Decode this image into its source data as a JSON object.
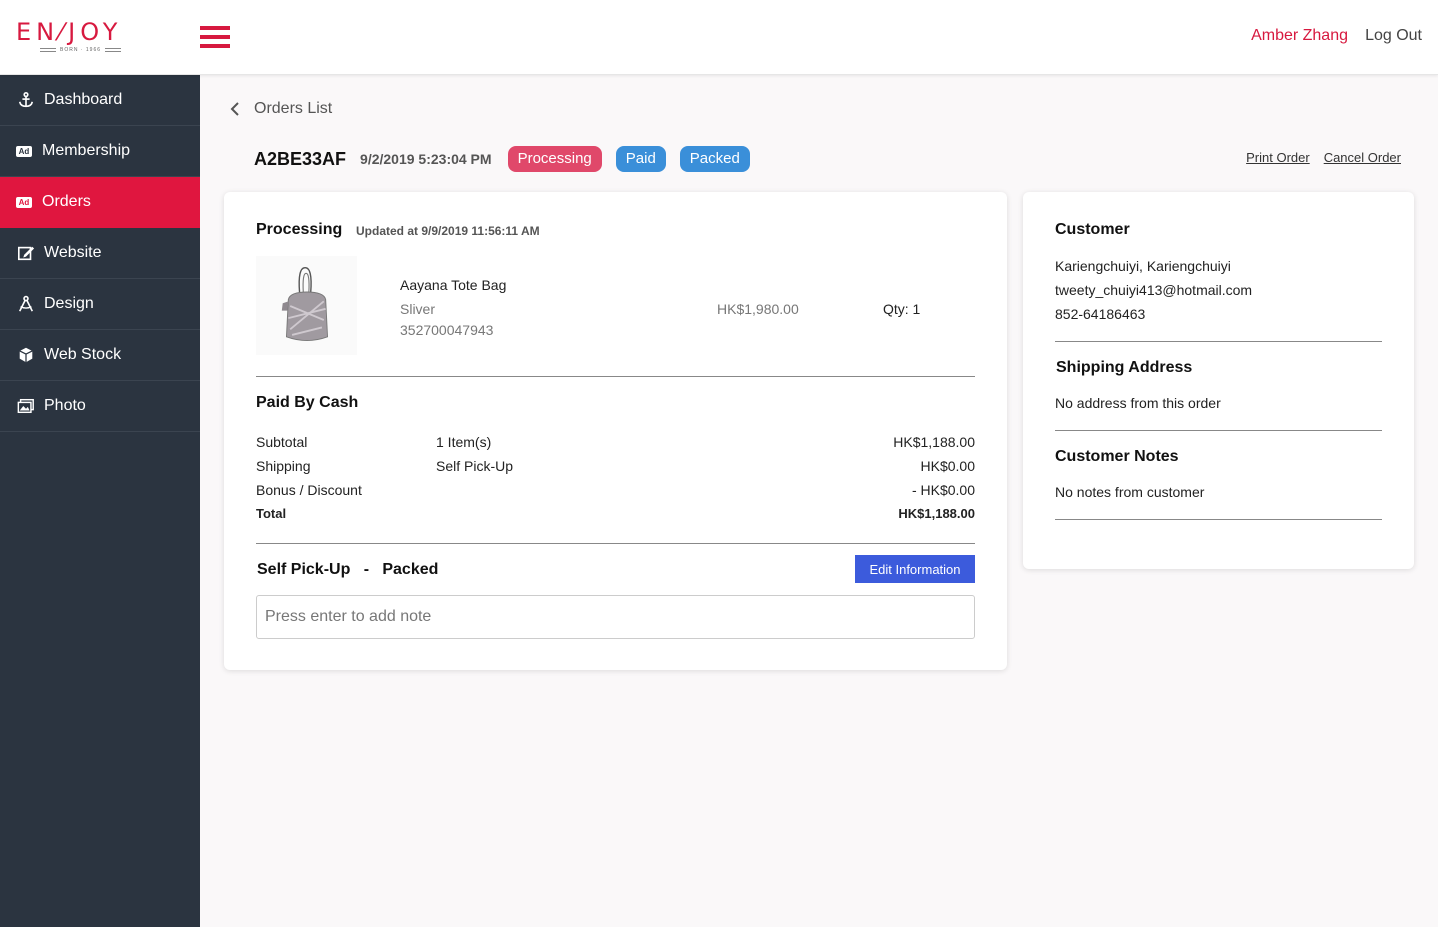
{
  "header": {
    "logo_text": "EN⁄JOY",
    "logo_sub": "BORN · 1966",
    "user_name": "Amber Zhang",
    "logout_label": "Log Out"
  },
  "sidebar": {
    "items": [
      {
        "label": "Dashboard",
        "icon": "anchor-icon"
      },
      {
        "label": "Membership",
        "icon": "ad-icon"
      },
      {
        "label": "Orders",
        "icon": "ad-icon",
        "active": true
      },
      {
        "label": "Website",
        "icon": "edit-icon"
      },
      {
        "label": "Design",
        "icon": "design-icon"
      },
      {
        "label": "Web Stock",
        "icon": "cube-icon"
      },
      {
        "label": "Photo",
        "icon": "images-icon"
      }
    ]
  },
  "breadcrumb": {
    "back_label": "Orders List"
  },
  "order": {
    "id": "A2BE33AF",
    "date": "9/2/2019 5:23:04 PM",
    "badges": [
      "Processing",
      "Paid",
      "Packed"
    ],
    "print_label": "Print Order",
    "cancel_label": "Cancel Order"
  },
  "status": {
    "title": "Processing",
    "updated": "Updated at 9/9/2019 11:56:11 AM"
  },
  "product": {
    "name": "Aayana Tote Bag",
    "variant": "Sliver",
    "sku": "352700047943",
    "price": "HK$1,980.00",
    "qty": "Qty: 1"
  },
  "payment": {
    "title": "Paid By Cash",
    "rows": [
      {
        "label": "Subtotal",
        "mid": "1 Item(s)",
        "value": "HK$1,188.00"
      },
      {
        "label": "Shipping",
        "mid": "Self Pick-Up",
        "value": "HK$0.00"
      },
      {
        "label": "Bonus / Discount",
        "mid": "",
        "value": "- HK$0.00"
      },
      {
        "label": "Total",
        "mid": "",
        "value": "HK$1,188.00"
      }
    ]
  },
  "fulfillment": {
    "title": "Self Pick-Up   -   Packed",
    "edit_label": "Edit Information",
    "note_placeholder": "Press enter to add note"
  },
  "customer": {
    "title": "Customer",
    "name": "Kariengchuiyi, Kariengchuiyi",
    "email": "tweety_chuiyi413@hotmail.com",
    "phone": "852-64186463",
    "shipping_title": "Shipping Address",
    "shipping_text": "No address from this order",
    "notes_title": "Customer Notes",
    "notes_text": "No notes from customer"
  },
  "colors": {
    "brand": "#d7193f",
    "sidebar_bg": "#2b3440",
    "active_nav": "#e0163f",
    "badge_processing": "#e0486a",
    "badge_blue": "#3a8fd9",
    "button_blue": "#3c5bdc"
  }
}
